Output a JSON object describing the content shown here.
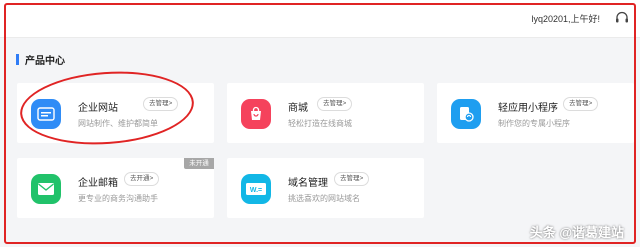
{
  "header": {
    "greeting": "lyq20201,上午好!",
    "support_icon": "headset-icon"
  },
  "section": {
    "title": "产品中心"
  },
  "products": [
    {
      "name": "企业网站",
      "button": "去管理>",
      "desc": "网站制作、维护都简单",
      "icon": "website-icon",
      "color": "#2f8cf6"
    },
    {
      "name": "商城",
      "button": "去管理>",
      "desc": "轻松打造在线商城",
      "icon": "shopping-bag-icon",
      "color": "#f5425c"
    },
    {
      "name": "轻应用小程序",
      "button": "去管理>",
      "desc": "制作您的专属小程序",
      "icon": "mini-program-icon",
      "color": "#1e9ef0"
    },
    {
      "name": "企业邮箱",
      "button": "去开通>",
      "desc": "更专业的商务沟通助手",
      "icon": "mail-icon",
      "color": "#21c26a",
      "badge": "未开通"
    },
    {
      "name": "域名管理",
      "button": "去管理>",
      "desc": "挑选喜欢的网站域名",
      "icon": "domain-icon",
      "color": "#12b7e6",
      "icon_text": "W.="
    }
  ],
  "watermark": "头条 @谐葛建站",
  "annotation_color": "#e02424",
  "accent_color": "#2f7cf6"
}
